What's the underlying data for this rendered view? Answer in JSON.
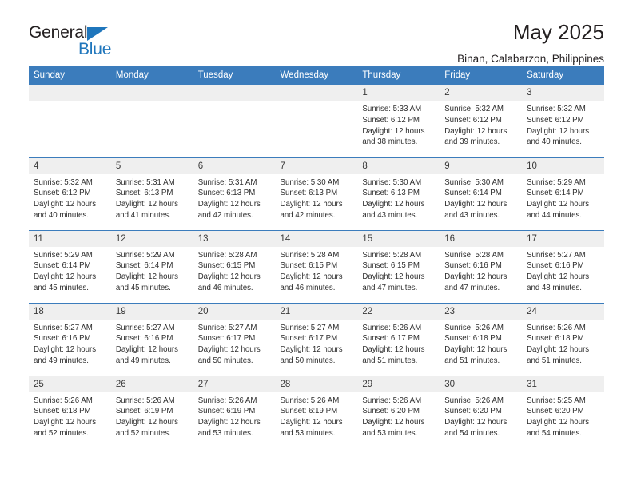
{
  "logo": {
    "word_top": "General",
    "word_bottom": "Blue",
    "triangle_color": "#1f76bc"
  },
  "header": {
    "title": "May 2025",
    "subtitle": "Binan, Calabarzon, Philippines"
  },
  "theme": {
    "header_bg": "#3b7cbc",
    "daynum_bg": "#efefef",
    "text": "#2e2e2e"
  },
  "weekdays": [
    "Sunday",
    "Monday",
    "Tuesday",
    "Wednesday",
    "Thursday",
    "Friday",
    "Saturday"
  ],
  "weeks": [
    [
      {
        "day": "",
        "blank": true
      },
      {
        "day": "",
        "blank": true
      },
      {
        "day": "",
        "blank": true
      },
      {
        "day": "",
        "blank": true
      },
      {
        "day": "1",
        "sunrise": "Sunrise: 5:33 AM",
        "sunset": "Sunset: 6:12 PM",
        "daylight1": "Daylight: 12 hours",
        "daylight2": "and 38 minutes."
      },
      {
        "day": "2",
        "sunrise": "Sunrise: 5:32 AM",
        "sunset": "Sunset: 6:12 PM",
        "daylight1": "Daylight: 12 hours",
        "daylight2": "and 39 minutes."
      },
      {
        "day": "3",
        "sunrise": "Sunrise: 5:32 AM",
        "sunset": "Sunset: 6:12 PM",
        "daylight1": "Daylight: 12 hours",
        "daylight2": "and 40 minutes."
      }
    ],
    [
      {
        "day": "4",
        "sunrise": "Sunrise: 5:32 AM",
        "sunset": "Sunset: 6:12 PM",
        "daylight1": "Daylight: 12 hours",
        "daylight2": "and 40 minutes."
      },
      {
        "day": "5",
        "sunrise": "Sunrise: 5:31 AM",
        "sunset": "Sunset: 6:13 PM",
        "daylight1": "Daylight: 12 hours",
        "daylight2": "and 41 minutes."
      },
      {
        "day": "6",
        "sunrise": "Sunrise: 5:31 AM",
        "sunset": "Sunset: 6:13 PM",
        "daylight1": "Daylight: 12 hours",
        "daylight2": "and 42 minutes."
      },
      {
        "day": "7",
        "sunrise": "Sunrise: 5:30 AM",
        "sunset": "Sunset: 6:13 PM",
        "daylight1": "Daylight: 12 hours",
        "daylight2": "and 42 minutes."
      },
      {
        "day": "8",
        "sunrise": "Sunrise: 5:30 AM",
        "sunset": "Sunset: 6:13 PM",
        "daylight1": "Daylight: 12 hours",
        "daylight2": "and 43 minutes."
      },
      {
        "day": "9",
        "sunrise": "Sunrise: 5:30 AM",
        "sunset": "Sunset: 6:14 PM",
        "daylight1": "Daylight: 12 hours",
        "daylight2": "and 43 minutes."
      },
      {
        "day": "10",
        "sunrise": "Sunrise: 5:29 AM",
        "sunset": "Sunset: 6:14 PM",
        "daylight1": "Daylight: 12 hours",
        "daylight2": "and 44 minutes."
      }
    ],
    [
      {
        "day": "11",
        "sunrise": "Sunrise: 5:29 AM",
        "sunset": "Sunset: 6:14 PM",
        "daylight1": "Daylight: 12 hours",
        "daylight2": "and 45 minutes."
      },
      {
        "day": "12",
        "sunrise": "Sunrise: 5:29 AM",
        "sunset": "Sunset: 6:14 PM",
        "daylight1": "Daylight: 12 hours",
        "daylight2": "and 45 minutes."
      },
      {
        "day": "13",
        "sunrise": "Sunrise: 5:28 AM",
        "sunset": "Sunset: 6:15 PM",
        "daylight1": "Daylight: 12 hours",
        "daylight2": "and 46 minutes."
      },
      {
        "day": "14",
        "sunrise": "Sunrise: 5:28 AM",
        "sunset": "Sunset: 6:15 PM",
        "daylight1": "Daylight: 12 hours",
        "daylight2": "and 46 minutes."
      },
      {
        "day": "15",
        "sunrise": "Sunrise: 5:28 AM",
        "sunset": "Sunset: 6:15 PM",
        "daylight1": "Daylight: 12 hours",
        "daylight2": "and 47 minutes."
      },
      {
        "day": "16",
        "sunrise": "Sunrise: 5:28 AM",
        "sunset": "Sunset: 6:16 PM",
        "daylight1": "Daylight: 12 hours",
        "daylight2": "and 47 minutes."
      },
      {
        "day": "17",
        "sunrise": "Sunrise: 5:27 AM",
        "sunset": "Sunset: 6:16 PM",
        "daylight1": "Daylight: 12 hours",
        "daylight2": "and 48 minutes."
      }
    ],
    [
      {
        "day": "18",
        "sunrise": "Sunrise: 5:27 AM",
        "sunset": "Sunset: 6:16 PM",
        "daylight1": "Daylight: 12 hours",
        "daylight2": "and 49 minutes."
      },
      {
        "day": "19",
        "sunrise": "Sunrise: 5:27 AM",
        "sunset": "Sunset: 6:16 PM",
        "daylight1": "Daylight: 12 hours",
        "daylight2": "and 49 minutes."
      },
      {
        "day": "20",
        "sunrise": "Sunrise: 5:27 AM",
        "sunset": "Sunset: 6:17 PM",
        "daylight1": "Daylight: 12 hours",
        "daylight2": "and 50 minutes."
      },
      {
        "day": "21",
        "sunrise": "Sunrise: 5:27 AM",
        "sunset": "Sunset: 6:17 PM",
        "daylight1": "Daylight: 12 hours",
        "daylight2": "and 50 minutes."
      },
      {
        "day": "22",
        "sunrise": "Sunrise: 5:26 AM",
        "sunset": "Sunset: 6:17 PM",
        "daylight1": "Daylight: 12 hours",
        "daylight2": "and 51 minutes."
      },
      {
        "day": "23",
        "sunrise": "Sunrise: 5:26 AM",
        "sunset": "Sunset: 6:18 PM",
        "daylight1": "Daylight: 12 hours",
        "daylight2": "and 51 minutes."
      },
      {
        "day": "24",
        "sunrise": "Sunrise: 5:26 AM",
        "sunset": "Sunset: 6:18 PM",
        "daylight1": "Daylight: 12 hours",
        "daylight2": "and 51 minutes."
      }
    ],
    [
      {
        "day": "25",
        "sunrise": "Sunrise: 5:26 AM",
        "sunset": "Sunset: 6:18 PM",
        "daylight1": "Daylight: 12 hours",
        "daylight2": "and 52 minutes."
      },
      {
        "day": "26",
        "sunrise": "Sunrise: 5:26 AM",
        "sunset": "Sunset: 6:19 PM",
        "daylight1": "Daylight: 12 hours",
        "daylight2": "and 52 minutes."
      },
      {
        "day": "27",
        "sunrise": "Sunrise: 5:26 AM",
        "sunset": "Sunset: 6:19 PM",
        "daylight1": "Daylight: 12 hours",
        "daylight2": "and 53 minutes."
      },
      {
        "day": "28",
        "sunrise": "Sunrise: 5:26 AM",
        "sunset": "Sunset: 6:19 PM",
        "daylight1": "Daylight: 12 hours",
        "daylight2": "and 53 minutes."
      },
      {
        "day": "29",
        "sunrise": "Sunrise: 5:26 AM",
        "sunset": "Sunset: 6:20 PM",
        "daylight1": "Daylight: 12 hours",
        "daylight2": "and 53 minutes."
      },
      {
        "day": "30",
        "sunrise": "Sunrise: 5:26 AM",
        "sunset": "Sunset: 6:20 PM",
        "daylight1": "Daylight: 12 hours",
        "daylight2": "and 54 minutes."
      },
      {
        "day": "31",
        "sunrise": "Sunrise: 5:25 AM",
        "sunset": "Sunset: 6:20 PM",
        "daylight1": "Daylight: 12 hours",
        "daylight2": "and 54 minutes."
      }
    ]
  ]
}
